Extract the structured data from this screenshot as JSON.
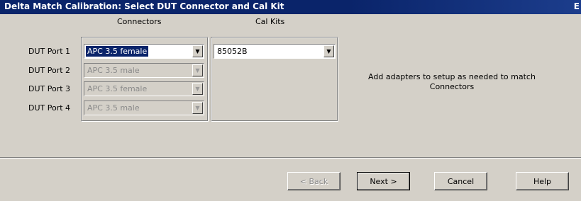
{
  "window": {
    "title": "Delta Match Calibration: Select DUT Connector and Cal Kit",
    "title_right": "E"
  },
  "connectors": {
    "header": "Connectors",
    "ports": [
      {
        "label": "DUT Port 1",
        "value": "APC 3.5 female"
      },
      {
        "label": "DUT Port 2",
        "value": "APC 3.5 male"
      },
      {
        "label": "DUT Port 3",
        "value": "APC 3.5 female"
      },
      {
        "label": "DUT Port 4",
        "value": "APC 3.5 male"
      }
    ]
  },
  "calkits": {
    "header": "Cal Kits",
    "value": "85052B"
  },
  "info_text": "Add adapters to setup as needed to match Connectors",
  "buttons": {
    "back": "< Back",
    "next": "Next >",
    "cancel": "Cancel",
    "help": "Help"
  }
}
